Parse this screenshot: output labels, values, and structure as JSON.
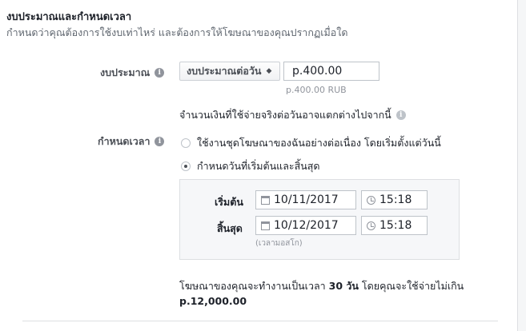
{
  "section": {
    "title": "งบประมาณและกำหนดเวลา",
    "subtitle": "กำหนดว่าคุณต้องการใช้งบเท่าไหร่ และต้องการให้โฆษณาของคุณปรากฏเมื่อใด"
  },
  "budget": {
    "label": "งบประมาณ",
    "type_selected": "งบประมาณต่อวัน",
    "amount_value": "p.400.00",
    "amount_note": "p.400.00 RUB",
    "spend_note": "จำนวนเงินที่ใช้จ่ายจริงต่อวันอาจแตกต่างไปจากนี้"
  },
  "schedule": {
    "label": "กำหนดเวลา",
    "options": [
      {
        "label": "ใช้งานชุดโฆษณาของฉันอย่างต่อเนื่อง โดยเริ่มตั้งแต่วันนี้",
        "checked": false
      },
      {
        "label": "กำหนดวันที่เริ่มต้นและสิ้นสุด",
        "checked": true
      }
    ],
    "start": {
      "label": "เริ่มต้น",
      "date": "10/11/2017",
      "time": "15:18"
    },
    "end": {
      "label": "สิ้นสุด",
      "date": "10/12/2017",
      "time": "15:18"
    },
    "timezone_note": "(เวลามอสโก)"
  },
  "summary": {
    "pre": "โฆษณาของคุณจะทำงานเป็นเวลา ",
    "days": "30 วัน",
    "post": " โดยคุณจะใช้จ่ายไม่เกิน",
    "max_spend": "p.12,000.00"
  },
  "icons": {
    "info": "info-icon",
    "select_arrows": "chevron-updown-icon",
    "calendar": "calendar-icon",
    "clock": "clock-icon"
  }
}
